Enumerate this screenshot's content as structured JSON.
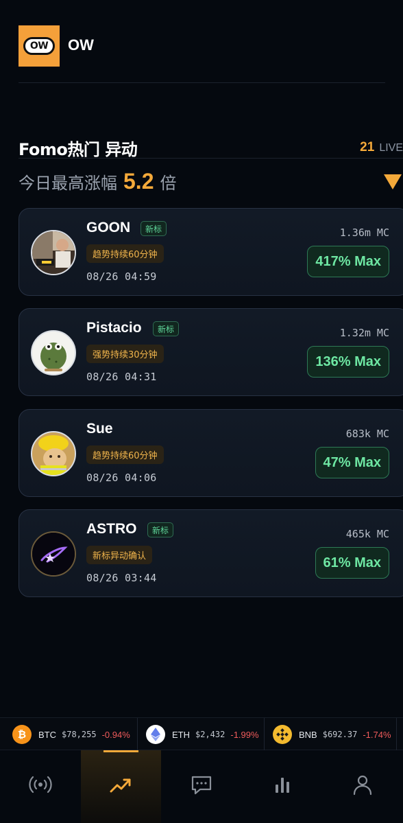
{
  "app": {
    "logo_text": "OW",
    "title": "OW"
  },
  "section": {
    "title": "Fomo热门 异动",
    "live_count": "21",
    "live_label": "LIVE",
    "subtitle_pre": "今日最高涨幅",
    "subtitle_value": "5.2",
    "subtitle_post": "倍"
  },
  "tokens": [
    {
      "name": "GOON",
      "badge": "新标",
      "tag": "趋势持续60分钟",
      "time": "08/26 04:59",
      "mc": "1.36m MC",
      "max": "417% Max",
      "avatar": "photo-avatar"
    },
    {
      "name": "Pistacio",
      "badge": "新标",
      "tag": "强势持续30分钟",
      "time": "08/26 04:31",
      "mc": "1.32m MC",
      "max": "136% Max",
      "avatar": "frog-avatar"
    },
    {
      "name": "Sue",
      "badge": "",
      "tag": "趋势持续60分钟",
      "time": "08/26 04:06",
      "mc": "683k MC",
      "max": "47% Max",
      "avatar": "cat-avatar"
    },
    {
      "name": "ASTRO",
      "badge": "新标",
      "tag": "新标异动确认",
      "time": "08/26 03:44",
      "mc": "465k MC",
      "max": "61% Max",
      "avatar": "star-avatar"
    }
  ],
  "ticker": [
    {
      "symbol": "BTC",
      "price": "$78,255",
      "change": "-0.94%",
      "icon": "bitcoin-icon",
      "color": "#f7931a"
    },
    {
      "symbol": "ETH",
      "price": "$2,432",
      "change": "-1.99%",
      "icon": "ethereum-icon",
      "color": "#ffffff"
    },
    {
      "symbol": "BNB",
      "price": "$692.37",
      "change": "-1.74%",
      "icon": "bnb-icon",
      "color": "#f3ba2f"
    }
  ],
  "nav": [
    {
      "name": "live-radar",
      "icon": "broadcast-icon",
      "active": false
    },
    {
      "name": "trending",
      "icon": "trending-up-icon",
      "active": true
    },
    {
      "name": "chat",
      "icon": "chat-icon",
      "active": false
    },
    {
      "name": "stats",
      "icon": "bar-chart-icon",
      "active": false
    },
    {
      "name": "profile",
      "icon": "user-icon",
      "active": false
    }
  ],
  "colors": {
    "accent": "#f4a93a",
    "gain": "#6ee7a3",
    "loss": "#ef5b5b",
    "background": "#05090f"
  }
}
